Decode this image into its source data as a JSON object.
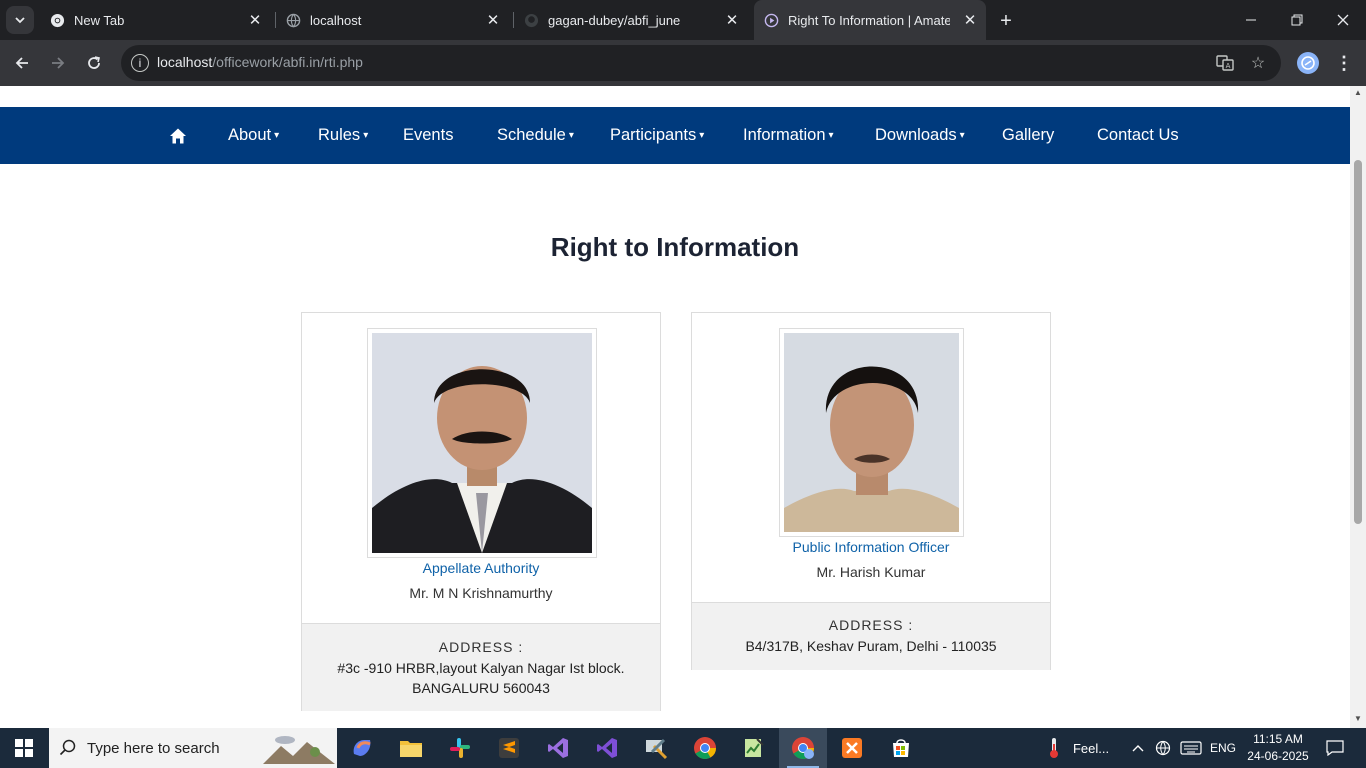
{
  "browser": {
    "tabs": [
      {
        "title": "New Tab",
        "favicon": "chrome-icon"
      },
      {
        "title": "localhost",
        "favicon": "globe-icon"
      },
      {
        "title": "gagan-dubey/abfi_june",
        "favicon": "github-icon"
      },
      {
        "title": "Right To Information | Amateur",
        "favicon": "site-icon"
      }
    ],
    "url_host": "localhost",
    "url_path": "/officework/abfi.in/rti.php"
  },
  "site": {
    "nav": [
      {
        "label": "About",
        "dropdown": true
      },
      {
        "label": "Rules",
        "dropdown": true
      },
      {
        "label": "Events",
        "dropdown": false
      },
      {
        "label": "Schedule",
        "dropdown": true
      },
      {
        "label": "Participants",
        "dropdown": true
      },
      {
        "label": "Information",
        "dropdown": true
      },
      {
        "label": "Downloads",
        "dropdown": true
      },
      {
        "label": "Gallery",
        "dropdown": false
      },
      {
        "label": "Contact Us",
        "dropdown": false
      }
    ],
    "caret": "▾",
    "page_title": "Right to Information",
    "officers": [
      {
        "role": "Appellate Authority",
        "name": "Mr. M N Krishnamurthy",
        "address_label": "ADDRESS :",
        "address_line1": "#3c -910 HRBR,layout Kalyan Nagar Ist block.",
        "address_line2": "BANGALURU 560043"
      },
      {
        "role": "Public Information Officer",
        "name": "Mr. Harish Kumar",
        "address_label": "ADDRESS :",
        "address_line1": "B4/317B, Keshav Puram, Delhi - 110035",
        "address_line2": ""
      }
    ]
  },
  "taskbar": {
    "search_placeholder": "Type here to search",
    "weather": "Feel...",
    "language": "ENG",
    "time": "11:15 AM",
    "date": "24-06-2025"
  },
  "colors": {
    "nav_bg": "#003a7d",
    "title": "#1c2333",
    "link": "#0f62a8"
  }
}
